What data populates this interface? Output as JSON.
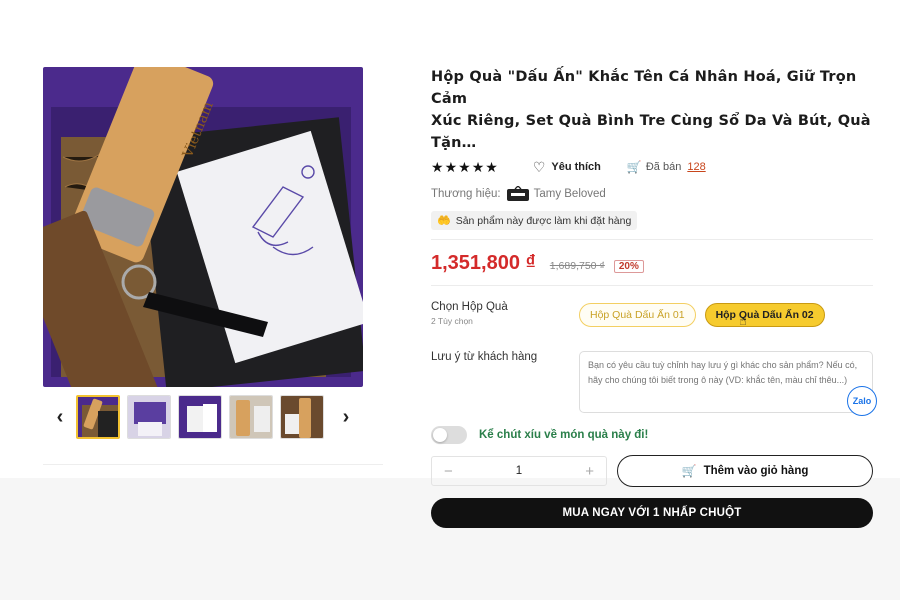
{
  "product": {
    "title_line1": "Hộp Quà \"Dấu Ấn\" Khắc Tên Cá Nhân Hoá, Giữ Trọn Cảm",
    "title_line2": "Xúc Riêng, Set Quà Bình Tre Cùng Sổ Da Và Bút, Quà Tặn…",
    "rating_stars": 5,
    "favorite_label": "Yêu thích",
    "sold_label": "Đã bán",
    "sold_count": "128",
    "brand_label": "Thương hiệu:",
    "brand_name": "Tamy Beloved",
    "made_to_order": "Sản phẩm này được làm khi đặt hàng",
    "price": "1,351,800 ₫",
    "old_price": "1,689,750 ₫",
    "discount": "20%"
  },
  "variant": {
    "label": "Chọn Hộp Quà",
    "sub_label": "2 Tùy chọn",
    "options": [
      "Hộp Quà Dấu Ấn 01",
      "Hộp Quà Dấu Ấn 02"
    ],
    "selected_index": 1
  },
  "note": {
    "label": "Lưu ý từ khách hàng",
    "placeholder": "Bạn có yêu cầu tuỳ chỉnh hay lưu ý gì khác cho sản phẩm? Nếu có, hãy cho chúng tôi biết trong ô này (VD: khắc tên, màu chỉ thêu...)"
  },
  "gift_toggle": {
    "label": "Kể chút xíu về món quà này đi!",
    "on": false
  },
  "cart": {
    "minus": "−",
    "plus": "+",
    "quantity": "1",
    "add_to_cart": "Thêm vào giỏ hàng",
    "buy_now": "MUA NGAY VỚI 1 NHẤP CHUỘT"
  },
  "gallery": {
    "prev": "‹",
    "next": "›",
    "thumb_count": 5,
    "active_thumb": 0
  },
  "widgets": {
    "zalo": "Zalo"
  },
  "colors": {
    "price": "#d42a2a",
    "accent_yellow": "#f6cb2e",
    "box_purple": "#4b2a8c"
  }
}
